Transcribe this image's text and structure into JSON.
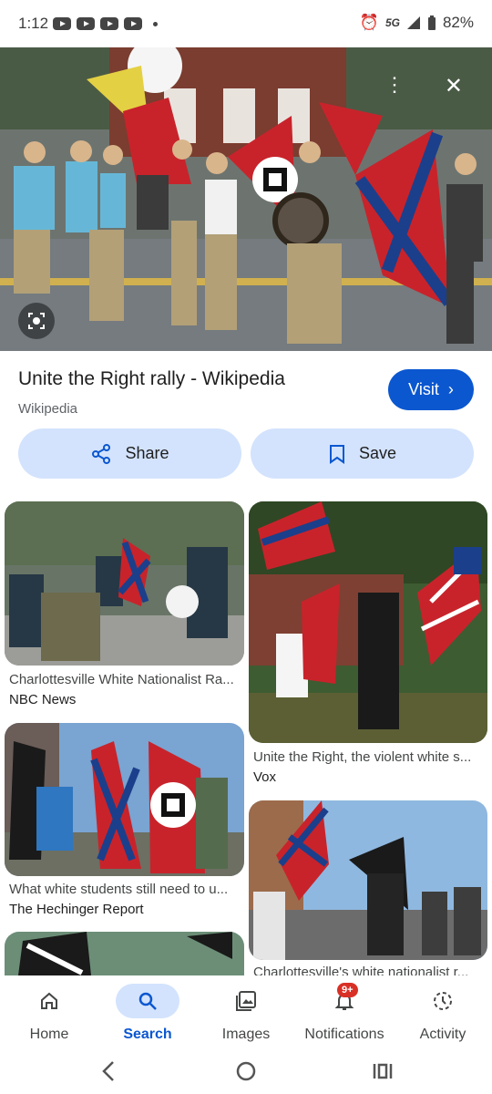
{
  "status": {
    "time": "1:12",
    "network": "5G",
    "battery": "82%"
  },
  "result": {
    "title": "Unite the Right rally - Wikipedia",
    "source": "Wikipedia",
    "visit": "Visit"
  },
  "actions": {
    "share": "Share",
    "save": "Save"
  },
  "related": [
    {
      "caption": "Charlottesville White Nationalist Ra...",
      "source": "NBC News"
    },
    {
      "caption": "Unite the Right, the violent white s...",
      "source": "Vox"
    },
    {
      "caption": "What white students still need to u...",
      "source": "The Hechinger Report"
    },
    {
      "caption": "Charlottesville's white nationalist r...",
      "source": ""
    }
  ],
  "nav": {
    "home": "Home",
    "search": "Search",
    "images": "Images",
    "notifications": "Notifications",
    "activity": "Activity",
    "badge": "9+"
  },
  "colors": {
    "accent": "#0b57d0",
    "tonal": "#d3e3fd"
  }
}
